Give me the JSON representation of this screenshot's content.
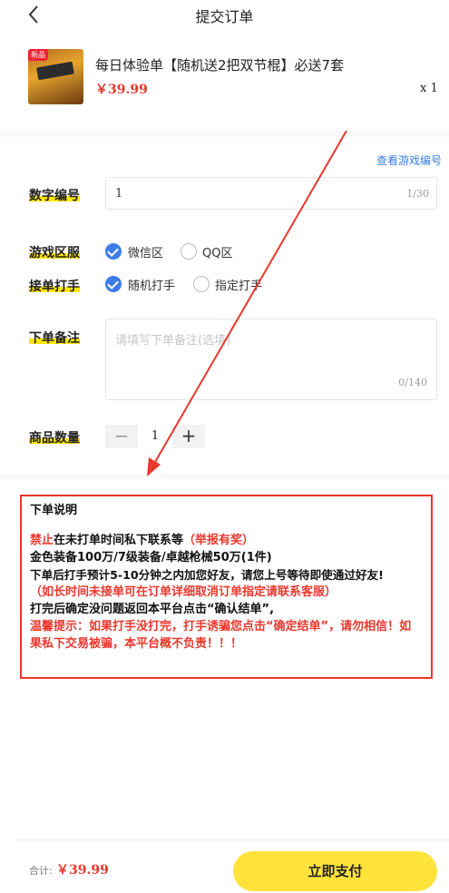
{
  "header": {
    "title": "提交订单"
  },
  "product": {
    "thumb_badge": "新品",
    "name": "每日体验单【随机送2把双节棍】必送7套",
    "price": "￥39.99",
    "quantity": "x 1"
  },
  "form": {
    "view_game_id_link": "查看游戏编号",
    "digit_id": {
      "label": "数字编号",
      "value": "1",
      "counter": "1/30"
    },
    "server": {
      "label": "游戏区服",
      "options": [
        "微信区",
        "QQ区"
      ],
      "selected": "微信区"
    },
    "booster": {
      "label": "接单打手",
      "options": [
        "随机打手",
        "指定打手"
      ],
      "selected": "随机打手"
    },
    "remark": {
      "label": "下单备注",
      "placeholder": "请填写下单备注(选填)",
      "counter": "0/140"
    },
    "quantity": {
      "label": "商品数量",
      "minus": "−",
      "value": "1",
      "plus": "+"
    }
  },
  "notice": {
    "title": "下单说明",
    "l1_red": "禁止",
    "l1_black": "在未打单时间私下联系等",
    "l1_red2": "（举报有奖）",
    "l2": "金色装备100万/7级装备/卓越枪械50万(1件)",
    "l3": "下单后打手预计5-10分钟之内加您好友，请您上号等待即使通过好友!",
    "l4": "（如长时间未接单可在订单详细取消订单指定请联系客服）",
    "l5": "打完后确定没问题返回本平台点击“确认结单”,",
    "l6": "温馨提示：如果打手没打完，打手诱骗您点击“确定结单”，请勿相信！如果私下交易被骗，本平台概不负责！！！"
  },
  "footer": {
    "total_label": "合计:",
    "total_value": "￥39.99",
    "pay_button": "立即支付"
  },
  "colors": {
    "accent_yellow": "#ffe33a",
    "price_red": "#e8382d",
    "link_blue": "#3b7fe0",
    "radio_blue": "#3d7ce8"
  }
}
